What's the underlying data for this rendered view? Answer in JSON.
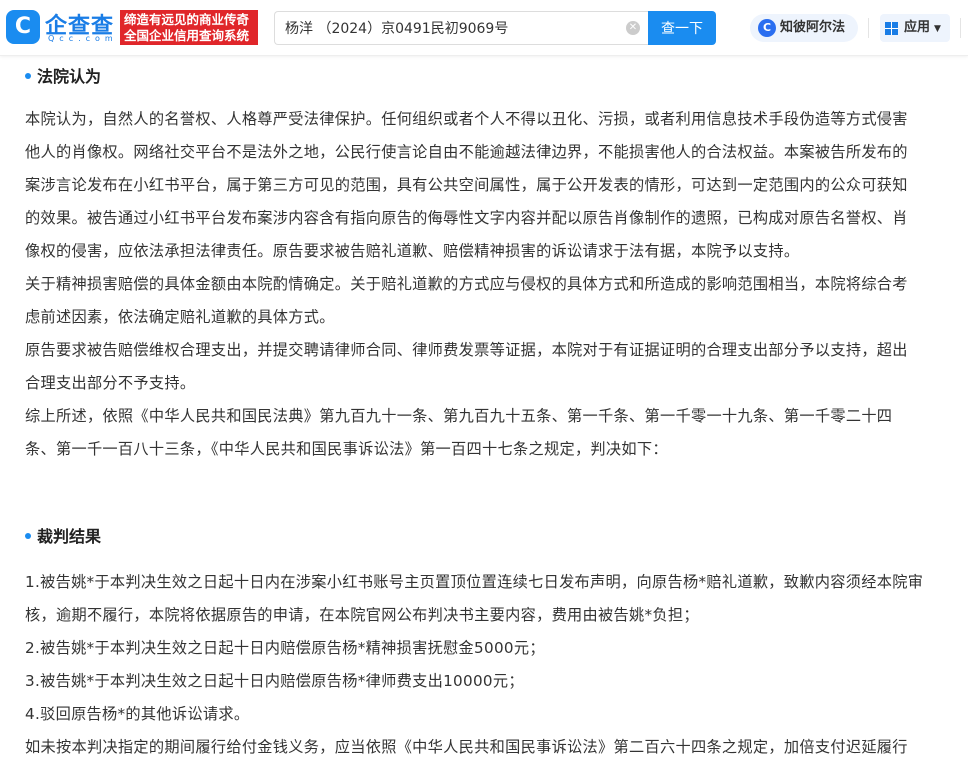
{
  "header": {
    "logo_mark": "C",
    "logo_name": "企查查",
    "logo_domain": "Qcc.com",
    "slogan_line1": "缔造有远见的商业传奇",
    "slogan_line2": "全国企业信用查询系统",
    "search_value": "杨洋 （2024）京0491民初9069号",
    "search_button": "查一下",
    "zhibi_label": "知彼阿尔法",
    "app_label": "应用"
  },
  "sections": [
    {
      "title": "法院认为",
      "lines": [
        "本院认为，自然人的名誉权、人格尊严受法律保护。任何组织或者个人不得以丑化、污损，或者利用信息技术手段伪造等方式侵害",
        "他人的肖像权。网络社交平台不是法外之地，公民行使言论自由不能逾越法律边界，不能损害他人的合法权益。本案被告所发布的",
        "案涉言论发布在小红书平台，属于第三方可见的范围，具有公共空间属性，属于公开发表的情形，可达到一定范围内的公众可获知",
        "的效果。被告通过小红书平台发布案涉内容含有指向原告的侮辱性文字内容并配以原告肖像制作的遗照，已构成对原告名誉权、肖",
        "像权的侵害，应依法承担法律责任。原告要求被告赔礼道歉、赔偿精神损害的诉讼请求于法有据，本院予以支持。",
        "关于精神损害赔偿的具体金额由本院酌情确定。关于赔礼道歉的方式应与侵权的具体方式和所造成的影响范围相当，本院将综合考",
        "虑前述因素，依法确定赔礼道歉的具体方式。",
        "原告要求被告赔偿维权合理支出，并提交聘请律师合同、律师费发票等证据，本院对于有证据证明的合理支出部分予以支持，超出",
        "合理支出部分不予支持。",
        "综上所述，依照《中华人民共和国民法典》第九百九十一条、第九百九十五条、第一千条、第一千零一十九条、第一千零二十四",
        "条、第一千一百八十三条，《中华人民共和国民事诉讼法》第一百四十七条之规定，判决如下："
      ]
    },
    {
      "title": "裁判结果",
      "lines": [
        "1.被告姚*于本判决生效之日起十日内在涉案小红书账号主页置顶位置连续七日发布声明，向原告杨*赔礼道歉，致歉内容须经本院审",
        "核，逾期不履行，本院将依据原告的申请，在本院官网公布判决书主要内容，费用由被告姚*负担；",
        "2.被告姚*于本判决生效之日起十日内赔偿原告杨*精神损害抚慰金5000元；",
        "3.被告姚*于本判决生效之日起十日内赔偿原告杨*律师费支出10000元；",
        "4.驳回原告杨*的其他诉讼请求。",
        "如未按本判决指定的期间履行给付金钱义务，应当依照《中华人民共和国民事诉讼法》第二百六十四条之规定，加倍支付迟延履行"
      ]
    }
  ]
}
